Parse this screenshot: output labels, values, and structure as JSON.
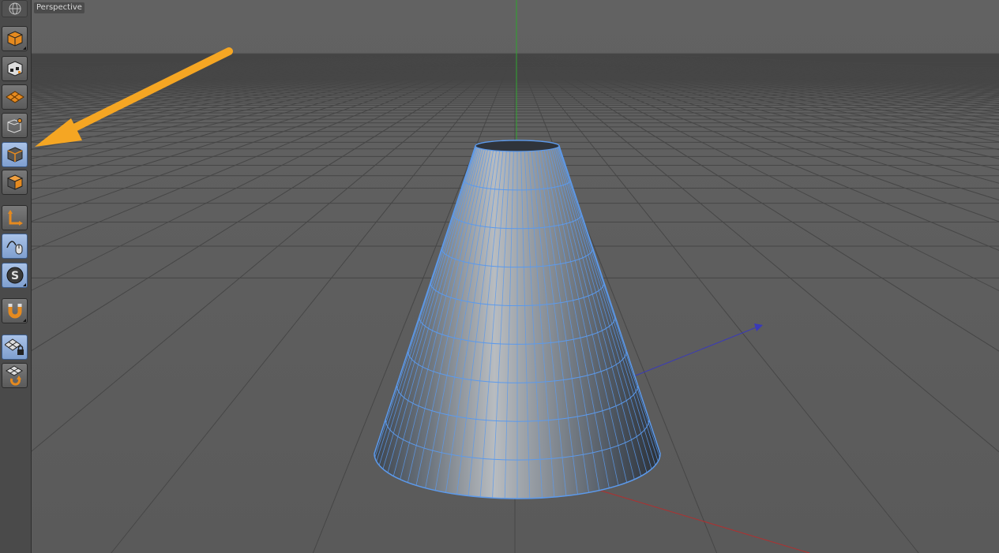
{
  "viewport": {
    "view_label": "Perspective",
    "colors": {
      "background": "#5a5a5a",
      "grid": "#464646",
      "y_axis": "#2fa52f",
      "x_axis": "#b03030",
      "z_axis": "#3a3ab8",
      "mesh_wire": "#5c9aec"
    }
  },
  "toolbar": {
    "items": [
      {
        "icon": "viewport-options-icon",
        "state": "normal"
      },
      {
        "icon": "model-mode-icon",
        "state": "normal"
      },
      {
        "icon": "texture-mode-icon",
        "state": "normal"
      },
      {
        "icon": "workplane-mode-icon",
        "state": "normal"
      },
      {
        "icon": "points-mode-icon",
        "state": "normal"
      },
      {
        "icon": "edges-mode-icon",
        "state": "active"
      },
      {
        "icon": "polygons-mode-icon",
        "state": "normal"
      },
      {
        "icon": "axis-mode-icon",
        "state": "normal"
      },
      {
        "icon": "tweak-mode-icon",
        "state": "active"
      },
      {
        "icon": "solo-mode-icon",
        "state": "active"
      },
      {
        "icon": "snap-magnet-icon",
        "state": "normal"
      },
      {
        "icon": "workplane-lock-icon",
        "state": "active"
      },
      {
        "icon": "workplane-align-icon",
        "state": "normal"
      }
    ]
  },
  "object": {
    "type": "cone",
    "selected": true
  },
  "annotation": {
    "type": "arrow",
    "color": "#f5a623",
    "points_to": "edges-mode-icon"
  }
}
